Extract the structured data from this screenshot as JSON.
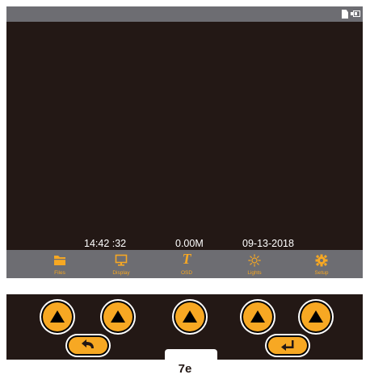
{
  "colors": {
    "accent": "#f7a823",
    "screen_background": "#231815",
    "bar_gray": "#6d6d72",
    "text_white": "#ffffff"
  },
  "status_icons": [
    "sd-card-icon",
    "battery-icon"
  ],
  "info": {
    "time": "14:42 :32",
    "storage": "0.00M",
    "date": "09-13-2018"
  },
  "menu": [
    {
      "label": "Files",
      "icon": "folder-icon"
    },
    {
      "label": "Display",
      "icon": "monitor-icon"
    },
    {
      "label": "OSD",
      "icon": "osd-text-icon",
      "glyph": "T"
    },
    {
      "label": "Lights",
      "icon": "sun-icon"
    },
    {
      "label": "Setup",
      "icon": "gear-icon"
    }
  ],
  "panel": {
    "up_buttons": [
      "up-arrow-icon",
      "up-arrow-icon",
      "up-arrow-icon",
      "up-arrow-icon",
      "up-arrow-icon"
    ],
    "back_button": {
      "icon": "back-arrow-icon"
    },
    "enter_button": {
      "icon": "enter-icon"
    }
  },
  "caption": "7e"
}
